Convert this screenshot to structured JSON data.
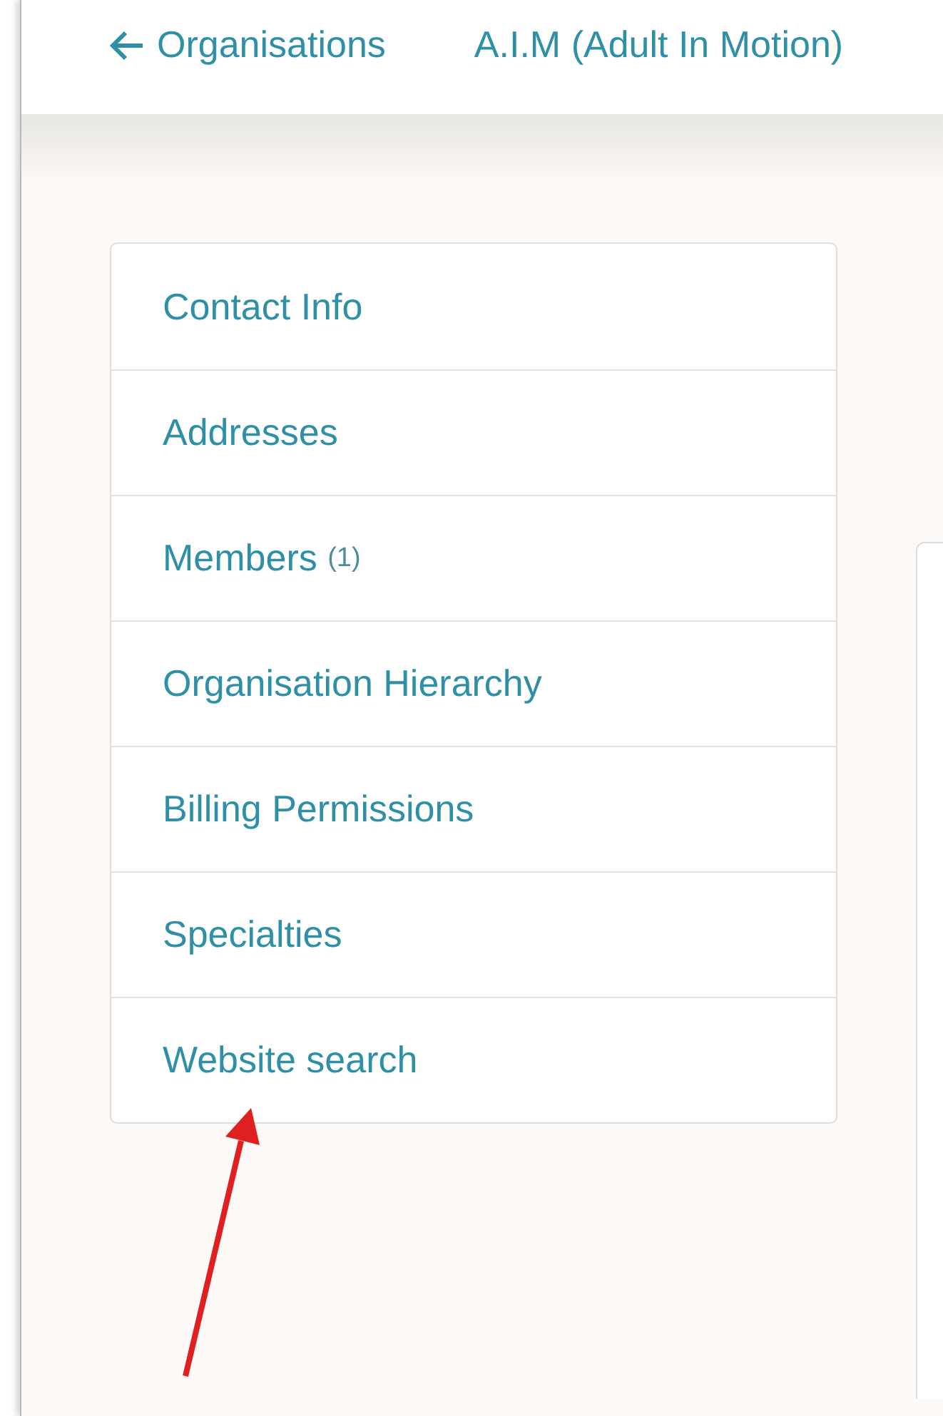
{
  "header": {
    "back_link": "Organisations",
    "title": "A.I.M (Adult In Motion)"
  },
  "sidebar": {
    "items": [
      {
        "label": "Contact Info"
      },
      {
        "label": "Addresses"
      },
      {
        "label": "Members",
        "count": "(1)"
      },
      {
        "label": "Organisation Hierarchy"
      },
      {
        "label": "Billing Permissions"
      },
      {
        "label": "Specialties"
      },
      {
        "label": "Website search"
      }
    ]
  },
  "annotation": {
    "kind": "arrow"
  }
}
